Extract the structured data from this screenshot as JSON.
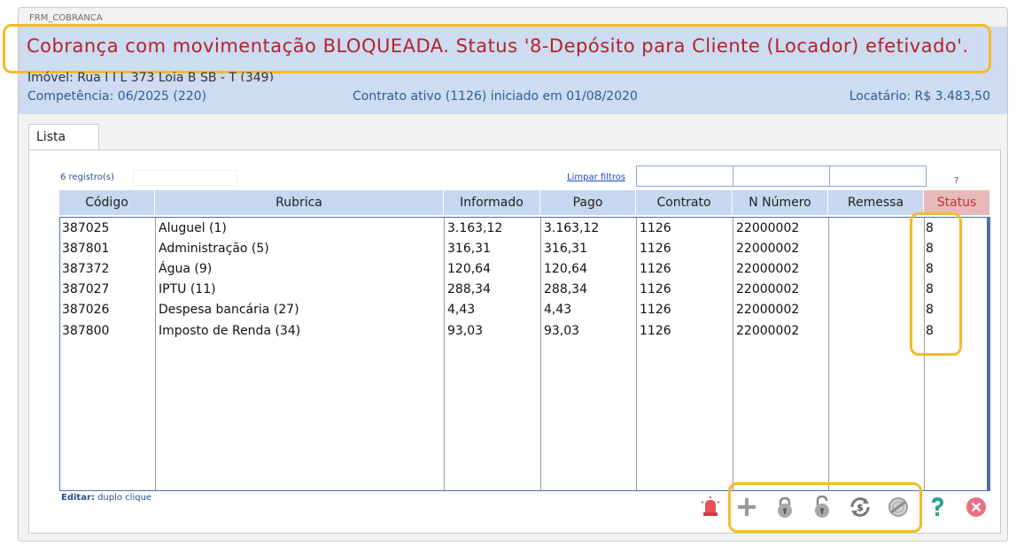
{
  "window": {
    "form_name": "FRM_COBRANCA"
  },
  "header": {
    "blocked_message": "Cobrança com movimentação BLOQUEADA. Status '8-Depósito para Cliente (Locador) efetivado'.",
    "imovel": "Imóvel: Rua I I L 373 Loja B SB - T (349)",
    "competencia": "Competência: 06/2025 (220)",
    "contrato": "Contrato ativo (1126) iniciado em 01/08/2020",
    "locatario": "Locatário: R$ 3.483,50"
  },
  "tabs": [
    {
      "label": "Lista"
    }
  ],
  "list": {
    "records": "6 registro(s)",
    "clear_filters": "Limpar filtros",
    "help_mark": "?",
    "edit_hint_label": "Editar:",
    "edit_hint_text": "duplo clique",
    "columns": [
      "Código",
      "Rubrica",
      "Informado",
      "Pago",
      "Contrato",
      "N Número",
      "Remessa",
      "Status"
    ],
    "rows": [
      [
        "387025",
        "Aluguel (1)",
        "3.163,12",
        "3.163,12",
        "1126",
        "22000002",
        "",
        "8"
      ],
      [
        "387801",
        "Administração (5)",
        "316,31",
        "316,31",
        "1126",
        "22000002",
        "",
        "8"
      ],
      [
        "387372",
        "Água (9)",
        "120,64",
        "120,64",
        "1126",
        "22000002",
        "",
        "8"
      ],
      [
        "387027",
        "IPTU (11)",
        "288,34",
        "288,34",
        "1126",
        "22000002",
        "",
        "8"
      ],
      [
        "387026",
        "Despesa bancária (27)",
        "4,43",
        "4,43",
        "1126",
        "22000002",
        "",
        "8"
      ],
      [
        "387800",
        "Imposto de Renda (34)",
        "93,03",
        "93,03",
        "1126",
        "22000002",
        "",
        "8"
      ]
    ]
  },
  "toolbar": {
    "icons": [
      "alarm-icon",
      "add-icon",
      "lock-icon",
      "unlock-icon",
      "payment-refresh-icon",
      "cancel-stamp-icon",
      "help-icon",
      "close-icon"
    ]
  },
  "colors": {
    "header_band": "#cddcf0",
    "blocked_text": "#b7202a",
    "highlight": "#f3bb2b",
    "status_header": "#e8b9b9"
  }
}
